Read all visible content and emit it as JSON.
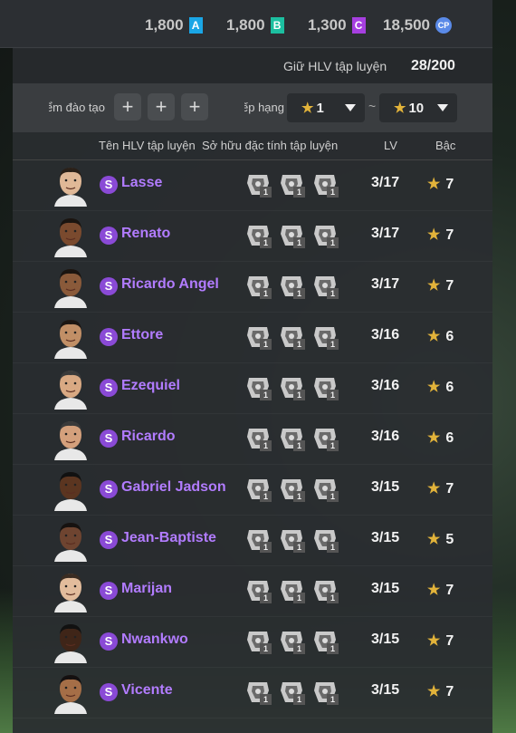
{
  "currency": [
    {
      "amount": "1,800",
      "badge": "A",
      "color": "#1aa6e6"
    },
    {
      "amount": "1,800",
      "badge": "B",
      "color": "#1cbfa0"
    },
    {
      "amount": "1,300",
      "badge": "C",
      "color": "#a63fe0"
    },
    {
      "amount": "18,500",
      "badge": "CP",
      "color": "#5a8ae8"
    }
  ],
  "hold": {
    "label": "Giữ HLV tập luyện",
    "value": "28/200"
  },
  "filters": {
    "training_label": "Điểm đào tạo",
    "rank_label": "Xếp hạng",
    "rank_from": "1",
    "rank_to": "10",
    "tilde": "~",
    "plus": "+"
  },
  "columns": {
    "name": "Tên HLV tập luyện",
    "traits": "Sở hữu đặc tính tập luyện",
    "lv": "LV",
    "rank": "Bậc"
  },
  "badge_letter": "S",
  "trait_level": "1",
  "coaches": [
    {
      "name": "Lasse",
      "lv": "3/17",
      "rank": "7"
    },
    {
      "name": "Renato",
      "lv": "3/17",
      "rank": "7"
    },
    {
      "name": "Ricardo Angel",
      "lv": "3/17",
      "rank": "7"
    },
    {
      "name": "Ettore",
      "lv": "3/16",
      "rank": "6"
    },
    {
      "name": "Ezequiel",
      "lv": "3/16",
      "rank": "6"
    },
    {
      "name": "Ricardo",
      "lv": "3/16",
      "rank": "6"
    },
    {
      "name": "Gabriel Jadson",
      "lv": "3/15",
      "rank": "7"
    },
    {
      "name": "Jean-Baptiste",
      "lv": "3/15",
      "rank": "5"
    },
    {
      "name": "Marijan",
      "lv": "3/15",
      "rank": "7"
    },
    {
      "name": "Nwankwo",
      "lv": "3/15",
      "rank": "7"
    },
    {
      "name": "Vicente",
      "lv": "3/15",
      "rank": "7"
    }
  ]
}
